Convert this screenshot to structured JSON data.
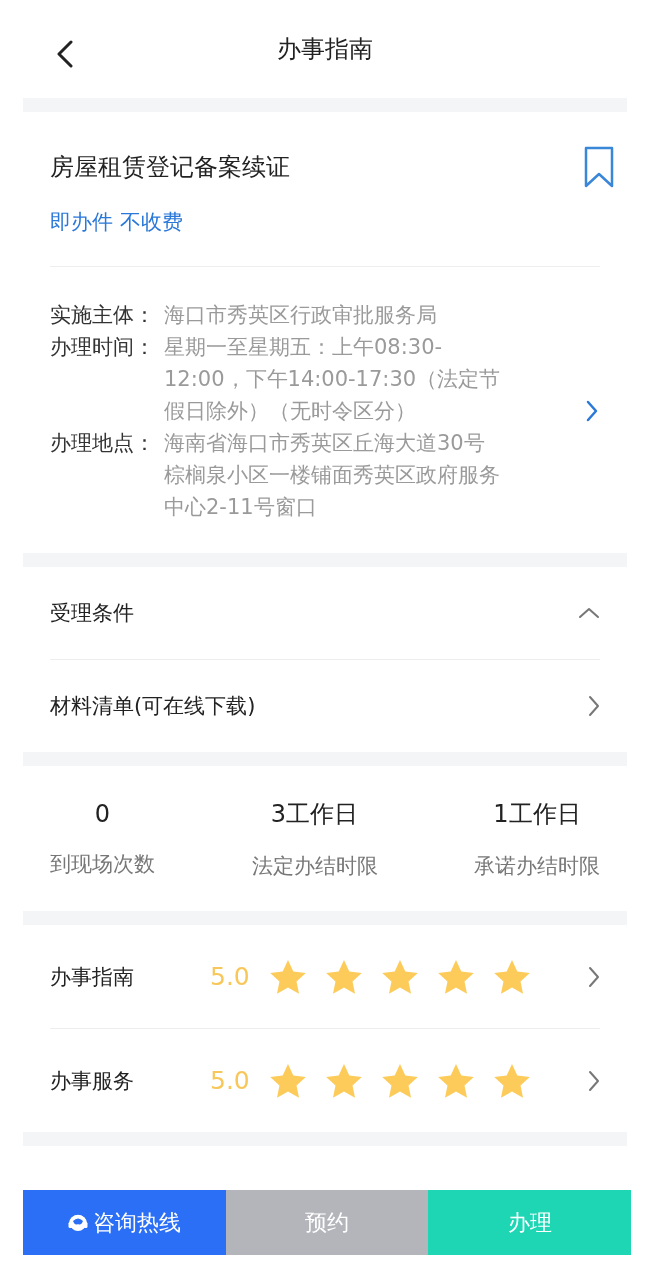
{
  "header": {
    "title": "办事指南"
  },
  "item": {
    "title": "房屋租赁登记备案续证",
    "bookmarked": false,
    "tags": "即办件 不收费"
  },
  "info": [
    {
      "label": "实施主体：",
      "value": "海口市秀英区行政审批服务局"
    },
    {
      "label": "办理时间：",
      "value": "星期一至星期五：上午08:30-12:00，下午14:00-17:30（法定节假日除外）（无时令区分）"
    },
    {
      "label": "办理地点：",
      "value": "海南省海口市秀英区丘海大道30号棕榈泉小区一楼铺面秀英区政府服务中心2-11号窗口"
    }
  ],
  "sections": [
    {
      "kind": "collapsible",
      "label": "受理条件",
      "expanded": true
    },
    {
      "kind": "link",
      "label": "材料清单(可在线下载)"
    }
  ],
  "stats": [
    {
      "value": "0",
      "label": "到现场次数"
    },
    {
      "value": "3工作日",
      "label": "法定办结时限"
    },
    {
      "value": "1工作日",
      "label": "承诺办结时限"
    }
  ],
  "ratings": [
    {
      "label": "办事指南",
      "score": "5.0",
      "stars": 5
    },
    {
      "label": "办事服务",
      "score": "5.0",
      "stars": 5
    }
  ],
  "buttons": [
    {
      "label": "咨询热线",
      "kind": "hotline",
      "disabled": false,
      "color": "#2a6ff5"
    },
    {
      "label": "预约",
      "kind": "plain",
      "disabled": true
    },
    {
      "label": "办理",
      "kind": "plain",
      "disabled": false,
      "color": "#1ed6b4"
    }
  ]
}
